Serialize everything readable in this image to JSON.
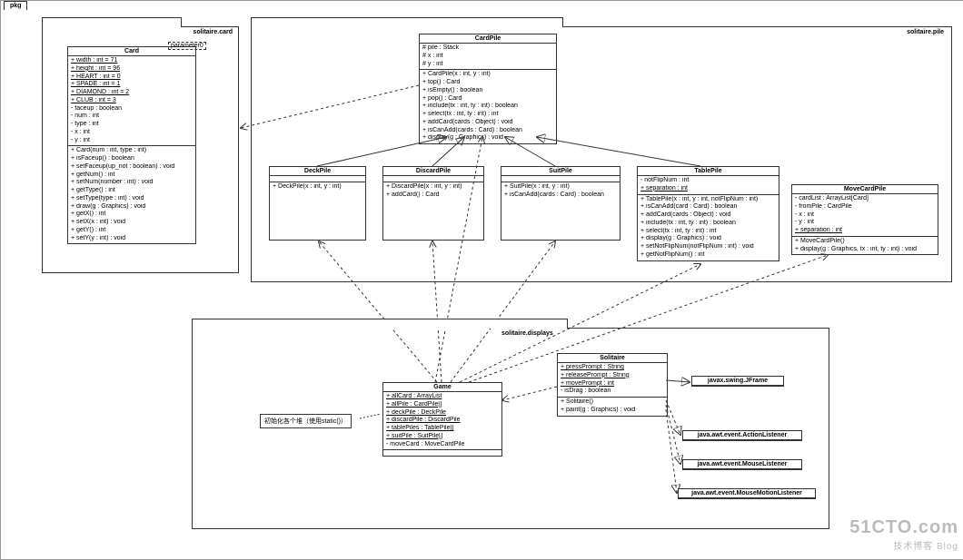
{
  "pkg": {
    "tab": "pkg"
  },
  "packages": {
    "card": "solitaire.card",
    "pile": "solitaire.pile",
    "displays": "solitaire.displays"
  },
  "paramTag": "parameter0",
  "classes": {
    "Card": {
      "name": "Card",
      "attrs": [
        "+ width : int = 71",
        "+ height : int = 96",
        "+ HEART : int = 0",
        "+ SPADE : int = 1",
        "+ DIAMOND : int = 2",
        "+ CLUB : int = 3",
        "- faceup : boolean",
        "- num : int",
        "- type : int",
        "- x : int",
        "- y : int"
      ],
      "ops": [
        "+ Card(num : int, type : int)",
        "+ isFaceup() : boolean",
        "+ setFaceup(up_not : boolean) : void",
        "+ getNum() : int",
        "+ setNum(number : int) : void",
        "+ getType() : int",
        "+ setType(type : int) : void",
        "+ draw(g : Graphics) : void",
        "+ getX() : int",
        "+ setX(x : int) : void",
        "+ getY() : int",
        "+ setY(y : int) : void"
      ]
    },
    "CardPile": {
      "name": "CardPile",
      "attrs": [
        "# pile : Stack",
        "# x : int",
        "# y : int"
      ],
      "ops": [
        "+ CardPile(x : int, y : int)",
        "+ top() : Card",
        "+ isEmpty() : boolean",
        "+ pop() : Card",
        "+ include(tx : int, ty : int) : boolean",
        "+ select(tx : int, ty : int) : int",
        "+ addCard(cards : Object) : void",
        "+ isCanAdd(cards : Card) : boolean",
        "+ display(g : Graphics) : void"
      ]
    },
    "DeckPile": {
      "name": "DeckPile",
      "attrs": [],
      "ops": [
        "+ DeckPile(x : int, y : int)"
      ]
    },
    "DiscardPile": {
      "name": "DiscardPile",
      "attrs": [],
      "ops": [
        "+ DiscardPile(x : int, y : int)",
        "+ addCard() : Card"
      ]
    },
    "SuitPile": {
      "name": "SuitPile",
      "attrs": [],
      "ops": [
        "+ SuitPile(x : int, y : int)",
        "+ isCanAdd(cards : Card) : boolean"
      ]
    },
    "TablePile": {
      "name": "TablePile",
      "attrs": [
        "- notFlipNum : int",
        "+ separation : int"
      ],
      "ops": [
        "+ TablePile(x : int, y : int, notFlipNum : int)",
        "+ isCanAdd(card : Card) : boolean",
        "+ addCard(cards : Object) : void",
        "+ include(tx : int, ty : int) : boolean",
        "+ select(tx : int, ty : int) : int",
        "+ display(g : Graphics) : void",
        "+ setNotFlipNum(notFlipNum : int) : void",
        "+ getNotFlipNum() : int"
      ]
    },
    "MoveCardPile": {
      "name": "MoveCardPile",
      "attrs": [
        "- cardList : ArrayList[Card]",
        "- fromPile : CardPile",
        "- x : int",
        "- y : int",
        "+ separation : int"
      ],
      "ops": [
        "+ MoveCardPile()",
        "+ display(g : Graphics, tx : int, ty : int) : void"
      ]
    },
    "Game": {
      "name": "Game",
      "attrs": [
        "+ allCard : ArrayList",
        "+ allPile : CardPile[]",
        "+ deckPile : DeckPile",
        "+ discardPile : DiscardPile",
        "+ tablePiles : TablePile[]",
        "+ suitPile : SuitPile[]",
        "- moveCard : MoveCardPile"
      ],
      "ops": []
    },
    "Solitaire": {
      "name": "Solitaire",
      "attrs": [
        "+ pressPrompt : String",
        "+ releasePrompt : String",
        "+ movePrompt : int",
        "- isDrag : boolean"
      ],
      "ops": [
        "+ Solitaire()",
        "+ paint(g : Graphics) : void"
      ]
    }
  },
  "externals": {
    "jframe": "javax.swing.JFrame",
    "action": "java.awt.event.ActionListener",
    "mouse": "java.awt.event.MouseListener",
    "motion": "java.awt.event.MouseMotionListener"
  },
  "noteText": "初始化各个堆（使用static()）",
  "watermark": {
    "main": "51CTO.com",
    "sub": "技术博客      Blog"
  }
}
